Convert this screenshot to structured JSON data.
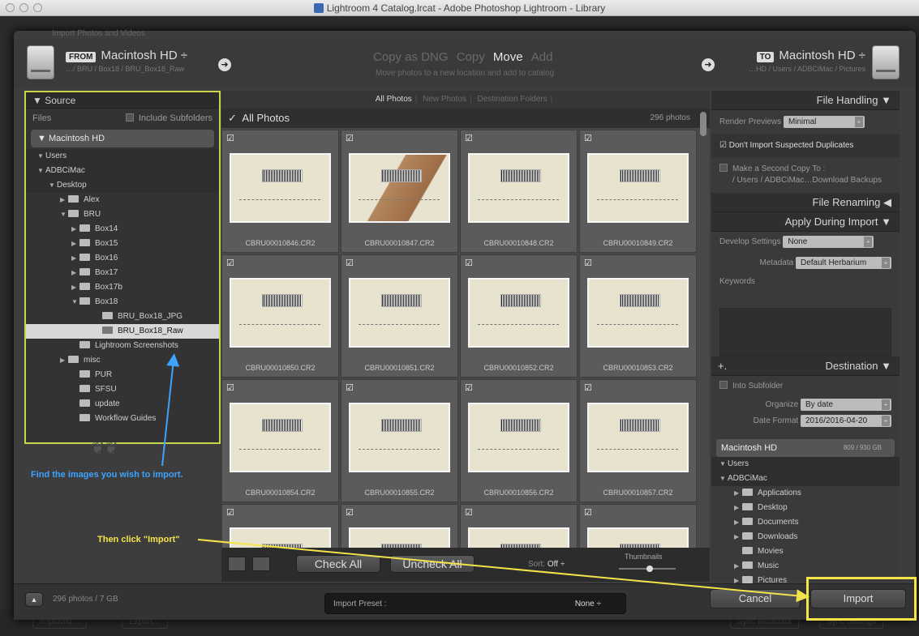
{
  "window": {
    "title": "Lightroom 4 Catalog.lrcat - Adobe Photoshop Lightroom - Library"
  },
  "dialog": {
    "top_label": "Import Photos and Videos"
  },
  "header": {
    "from_tag": "FROM",
    "from_volume": "Macintosh HD ÷",
    "from_path": "…/ BRU / Box18 / BRU_Box18_Raw",
    "modes": [
      "Copy as DNG",
      "Copy",
      "Move",
      "Add"
    ],
    "active_mode": "Move",
    "mode_description": "Move photos to a new location and add to catalog",
    "to_tag": "TO",
    "to_volume": "Macintosh HD ÷",
    "to_path": "…HD / Users / ADBCiMac / Pictures"
  },
  "source": {
    "title": "Source",
    "files_label": "Files",
    "include_subfolders": "Include Subfolders",
    "volume": "Macintosh HD",
    "tree": [
      {
        "label": "Users",
        "level": 0,
        "expanded": true,
        "folder": false,
        "band": true
      },
      {
        "label": "ADBCiMac",
        "level": 0,
        "expanded": true,
        "folder": false,
        "band": true
      },
      {
        "label": "Desktop",
        "level": 1,
        "expanded": true,
        "folder": false,
        "band": true
      },
      {
        "label": "Alex",
        "level": 2,
        "expanded": false,
        "folder": true
      },
      {
        "label": "BRU",
        "level": 2,
        "expanded": true,
        "folder": true
      },
      {
        "label": "Box14",
        "level": 3,
        "expanded": false,
        "folder": true
      },
      {
        "label": "Box15",
        "level": 3,
        "expanded": false,
        "folder": true
      },
      {
        "label": "Box16",
        "level": 3,
        "expanded": false,
        "folder": true
      },
      {
        "label": "Box17",
        "level": 3,
        "expanded": false,
        "folder": true
      },
      {
        "label": "Box17b",
        "level": 3,
        "expanded": false,
        "folder": true
      },
      {
        "label": "Box18",
        "level": 3,
        "expanded": true,
        "folder": true
      },
      {
        "label": "BRU_Box18_JPG",
        "level": 5,
        "folder": true
      },
      {
        "label": "BRU_Box18_Raw",
        "level": 5,
        "folder": true,
        "selected": true
      },
      {
        "label": "Lightroom Screenshots",
        "level": 3,
        "folder": true
      },
      {
        "label": "misc",
        "level": 2,
        "expanded": false,
        "folder": true
      },
      {
        "label": "PUR",
        "level": 3,
        "folder": true
      },
      {
        "label": "SFSU",
        "level": 3,
        "folder": true
      },
      {
        "label": "update",
        "level": 3,
        "folder": true
      },
      {
        "label": "Workflow Guides",
        "level": 3,
        "folder": true
      }
    ]
  },
  "annotations": {
    "find_images": "Find the images you wish to import.",
    "then_click": "Then click \"Import\""
  },
  "grid": {
    "tabs": [
      "All Photos",
      "New Photos",
      "Destination Folders"
    ],
    "active_tab": "All Photos",
    "header_title": "All Photos",
    "photo_count": "296 photos",
    "photos": [
      "CBRU00010846.CR2",
      "CBRU00010847.CR2",
      "CBRU00010848.CR2",
      "CBRU00010849.CR2",
      "CBRU00010850.CR2",
      "CBRU00010851.CR2",
      "CBRU00010852.CR2",
      "CBRU00010853.CR2",
      "CBRU00010854.CR2",
      "CBRU00010855.CR2",
      "CBRU00010856.CR2",
      "CBRU00010857.CR2",
      "",
      "",
      "",
      ""
    ],
    "check_all": "Check All",
    "uncheck_all": "Uncheck All",
    "sort_label": "Sort:",
    "sort_value": "Off ÷",
    "thumbnails_label": "Thumbnails"
  },
  "file_handling": {
    "title": "File Handling",
    "render_previews_label": "Render Previews",
    "render_previews_value": "Minimal",
    "dont_import_duplicates": "Don't Import Suspected Duplicates",
    "second_copy": "Make a Second Copy To :",
    "second_copy_path": "/ Users / ADBCiMac…Download Backups"
  },
  "file_renaming": {
    "title": "File Renaming"
  },
  "apply_during_import": {
    "title": "Apply During Import",
    "develop_label": "Develop Settings",
    "develop_value": "None",
    "metadata_label": "Metadata",
    "metadata_value": "Default Herbarium",
    "keywords_label": "Keywords"
  },
  "destination": {
    "title": "Destination",
    "plus": "+.",
    "into_subfolder": "Into Subfolder",
    "organize_label": "Organize",
    "organize_value": "By date",
    "date_format_label": "Date Format",
    "date_format_value": "2016/2016-04-20",
    "volume": "Macintosh HD",
    "volume_space": "809 / 930 GB",
    "tree": [
      "Users",
      "ADBCiMac",
      "Applications",
      "Desktop",
      "Documents",
      "Downloads",
      "Movies",
      "Music",
      "Pictures"
    ]
  },
  "footer": {
    "summary": "296 photos / 7 GB",
    "preset_label": "Import Preset :",
    "preset_value": "None ÷",
    "cancel": "Cancel",
    "import": "Import"
  },
  "background": {
    "ghost_labels": [
      "Imported…",
      "Export…",
      "Sync Metadata",
      "Sync Settings"
    ]
  }
}
